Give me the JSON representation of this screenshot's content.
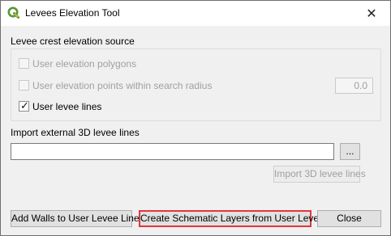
{
  "window": {
    "title": "Levees Elevation Tool",
    "close_symbol": "✕",
    "app_icon": "qgis-logo-icon"
  },
  "source_section": {
    "label": "Levee crest elevation source",
    "options": [
      {
        "label": "User elevation polygons",
        "checked": false,
        "enabled": false
      },
      {
        "label": "User elevation points within search radius",
        "checked": false,
        "enabled": false
      },
      {
        "label": "User levee lines",
        "checked": true,
        "enabled": true
      }
    ],
    "search_radius_value": "0.0"
  },
  "import_section": {
    "label": "Import external 3D levee lines",
    "path_value": "",
    "browse_label": "...",
    "import_label": "Import 3D levee lines"
  },
  "footer": {
    "add_walls_label": "Add Walls to User Levee Lines",
    "create_schematic_label": "Create Schematic Layers from User Levees",
    "close_label": "Close"
  },
  "colors": {
    "focus_border": "#e0373c",
    "qgis_green": "#589632",
    "qgis_yellow": "#eebf30"
  }
}
